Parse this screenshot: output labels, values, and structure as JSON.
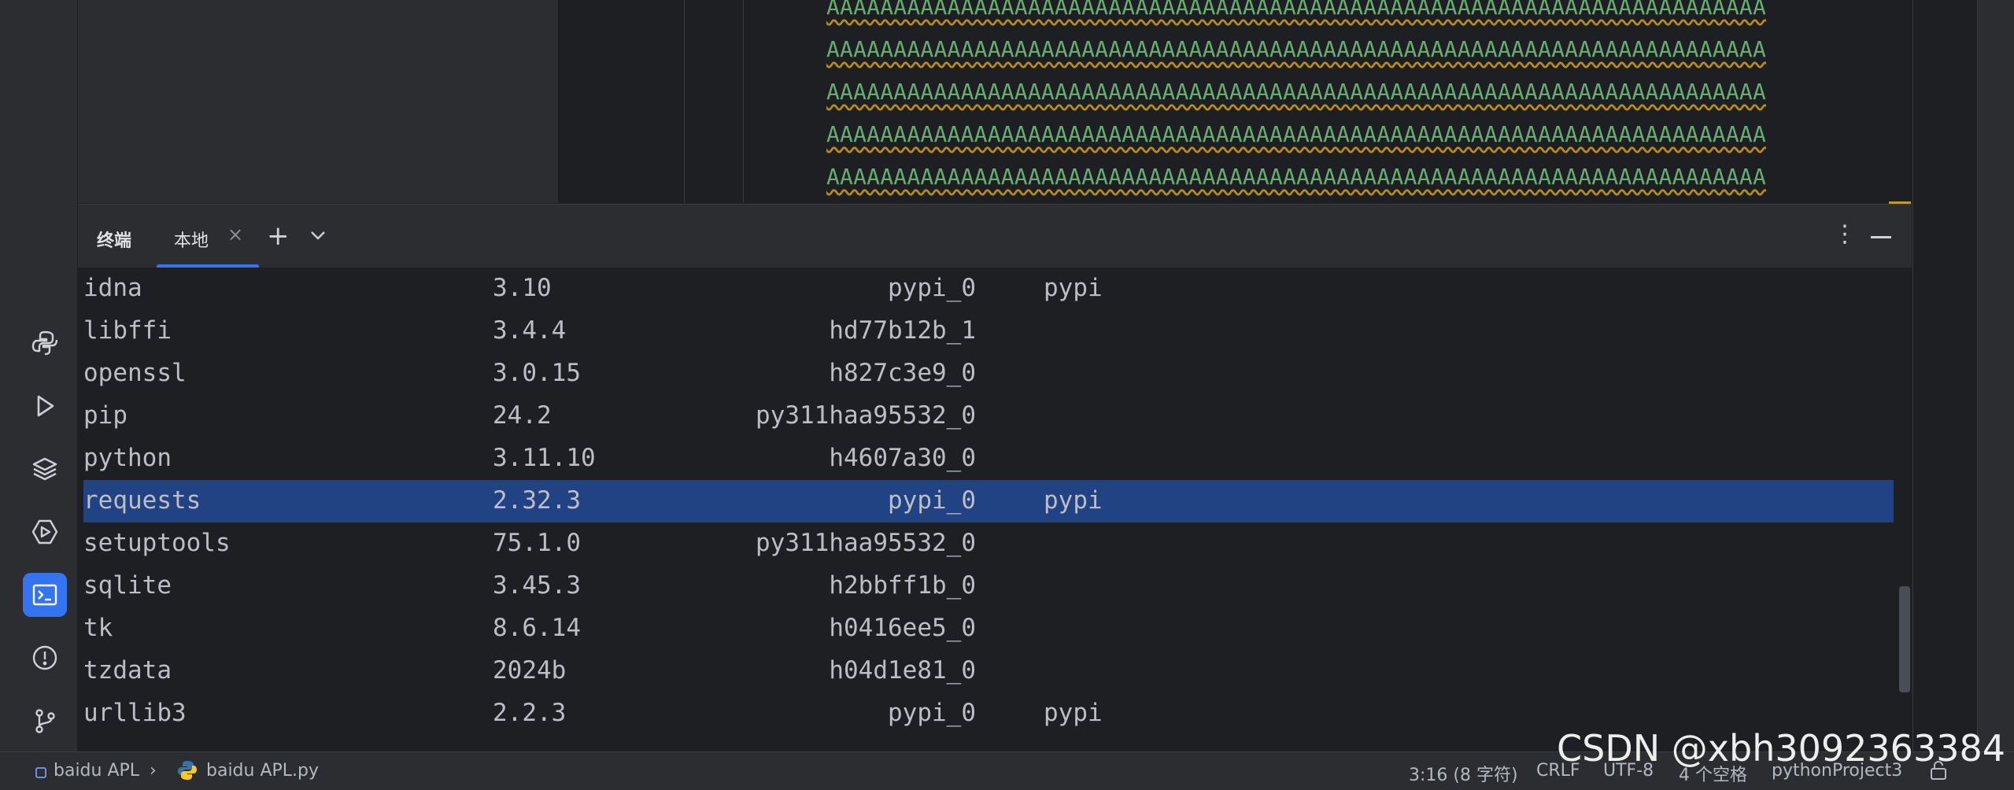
{
  "editor": {
    "code_lines": [
      "AAAAAAAAAAAAAAAAAAAAAAAAAAAAAAAAAAAAAAAAAAAAAAAAAAAAAAAAAAAAAAAAAAAAAA",
      "AAAAAAAAAAAAAAAAAAAAAAAAAAAAAAAAAAAAAAAAAAAAAAAAAAAAAAAAAAAAAAAAAAAAAA",
      "AAAAAAAAAAAAAAAAAAAAAAAAAAAAAAAAAAAAAAAAAAAAAAAAAAAAAAAAAAAAAAAAAAAAAA",
      "AAAAAAAAAAAAAAAAAAAAAAAAAAAAAAAAAAAAAAAAAAAAAAAAAAAAAAAAAAAAAAAAAAAAAA",
      "AAAAAAAAAAAAAAAAAAAAAAAAAAAAAAAAAAAAAAAAAAAAAAAAAAAAAAAAAAAAAAAAAAAAAA"
    ],
    "string_color": "#6aab73"
  },
  "terminal": {
    "title": "终端",
    "tabs": [
      {
        "label": "本地",
        "active": true
      }
    ],
    "close_glyph": "×",
    "add_glyph": "+",
    "more_glyph": "⋮",
    "packages": [
      {
        "name": "idna",
        "version": "3.10",
        "build": "pypi_0",
        "channel": "pypi"
      },
      {
        "name": "libffi",
        "version": "3.4.4",
        "build": "hd77b12b_1",
        "channel": ""
      },
      {
        "name": "openssl",
        "version": "3.0.15",
        "build": "h827c3e9_0",
        "channel": ""
      },
      {
        "name": "pip",
        "version": "24.2",
        "build": "py311haa95532_0",
        "channel": ""
      },
      {
        "name": "python",
        "version": "3.11.10",
        "build": "h4607a30_0",
        "channel": ""
      },
      {
        "name": "requests",
        "version": "2.32.3",
        "build": "pypi_0",
        "channel": "pypi",
        "selected": true
      },
      {
        "name": "setuptools",
        "version": "75.1.0",
        "build": "py311haa95532_0",
        "channel": ""
      },
      {
        "name": "sqlite",
        "version": "3.45.3",
        "build": "h2bbff1b_0",
        "channel": ""
      },
      {
        "name": "tk",
        "version": "8.6.14",
        "build": "h0416ee5_0",
        "channel": ""
      },
      {
        "name": "tzdata",
        "version": "2024b",
        "build": "h04d1e81_0",
        "channel": ""
      },
      {
        "name": "urllib3",
        "version": "2.2.3",
        "build": "pypi_0",
        "channel": "pypi"
      }
    ],
    "selection_color": "#214283"
  },
  "sidebar": {
    "tools": [
      {
        "name": "python-console-icon",
        "active": false
      },
      {
        "name": "run-icon",
        "active": false
      },
      {
        "name": "python-packages-icon",
        "active": false
      },
      {
        "name": "services-icon",
        "active": false
      },
      {
        "name": "terminal-icon",
        "active": true
      },
      {
        "name": "problems-icon",
        "active": false
      },
      {
        "name": "git-icon",
        "active": false
      }
    ],
    "accent": "#3574f0"
  },
  "status_bar": {
    "project": "baidu APL",
    "separator": "›",
    "file": "baidu APL.py",
    "position": "3:16 (8 字符)",
    "line_ending": "CRLF",
    "encoding": "UTF-8",
    "indent": "4 个空格",
    "interpreter": "pythonProject3"
  },
  "watermark": {
    "text": "CSDN @xbh3092363384"
  }
}
